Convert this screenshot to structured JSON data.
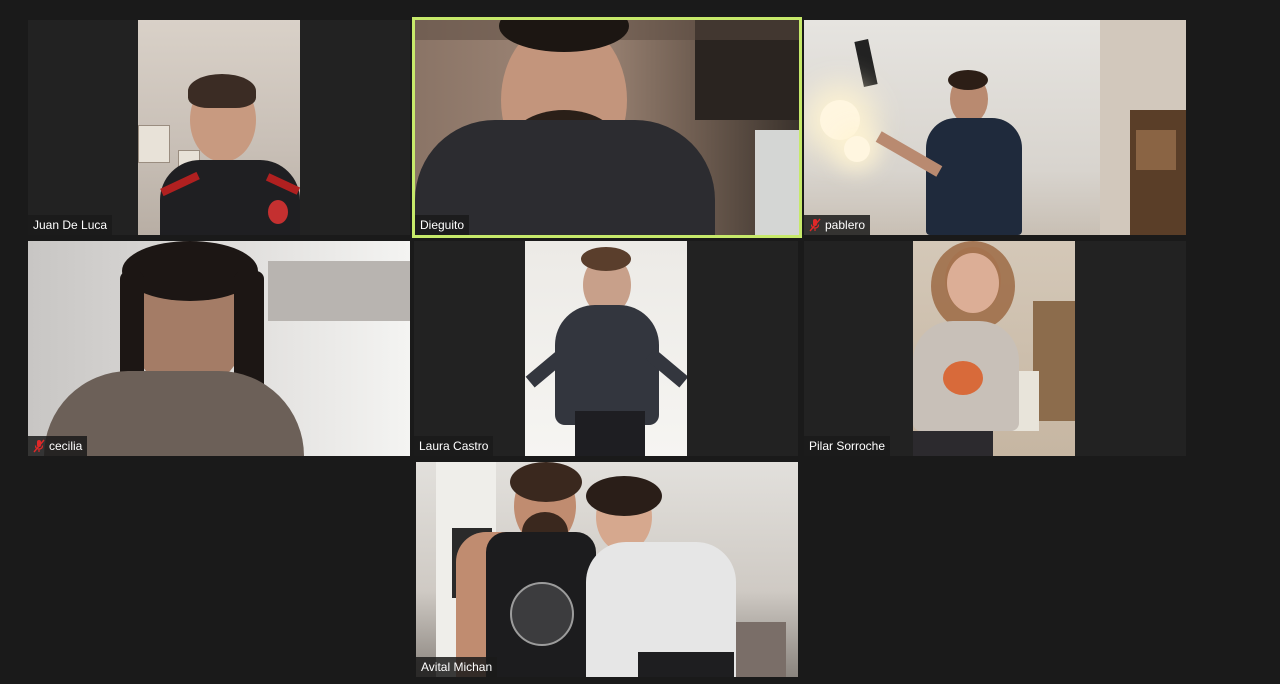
{
  "meeting": {
    "layout": "gallery-view",
    "active_speaker": "Dieguito",
    "colors": {
      "background": "#1a1a1a",
      "tile": "#222222",
      "speaker_border": "#c6e96a",
      "muted_icon": "#e02828",
      "name_text": "#ffffff"
    }
  },
  "participants": [
    {
      "name": "Juan De Luca",
      "muted": false,
      "speaking": false
    },
    {
      "name": "Dieguito",
      "muted": false,
      "speaking": true
    },
    {
      "name": "pablero",
      "muted": true,
      "speaking": false
    },
    {
      "name": "cecilia",
      "muted": true,
      "speaking": false
    },
    {
      "name": "Laura Castro",
      "muted": false,
      "speaking": false
    },
    {
      "name": "Pilar Sorroche",
      "muted": false,
      "speaking": false
    },
    {
      "name": "Avital Michan",
      "muted": false,
      "speaking": false
    }
  ]
}
